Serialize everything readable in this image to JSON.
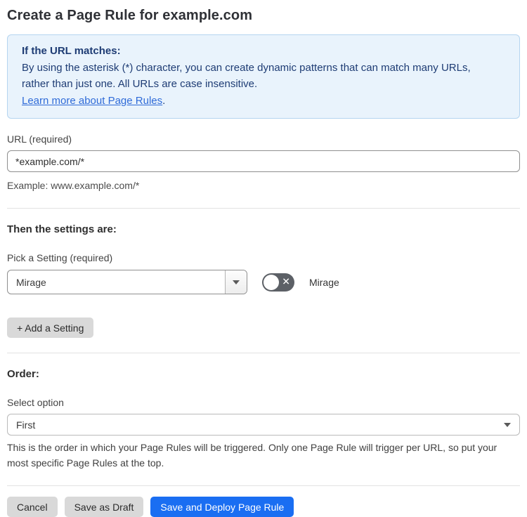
{
  "page": {
    "title": "Create a Page Rule for example.com"
  },
  "info_box": {
    "heading": "If the URL matches:",
    "body": "By using the asterisk (*) character, you can create dynamic patterns that can match many URLs, rather than just one. All URLs are case insensitive.",
    "link_label": "Learn more about Page Rules",
    "link_suffix": "."
  },
  "url_field": {
    "label": "URL (required)",
    "value": "*example.com/*",
    "helper": "Example: www.example.com/*"
  },
  "settings_section": {
    "heading": "Then the settings are:",
    "picker_label": "Pick a Setting (required)",
    "selected_setting": "Mirage",
    "toggle": {
      "label": "Mirage",
      "state": "off",
      "glyph": "✕"
    },
    "add_button_label": "+ Add a Setting"
  },
  "order_section": {
    "heading": "Order:",
    "label": "Select option",
    "selected_option": "First",
    "helper": "This is the order in which your Page Rules will be triggered. Only one Page Rule will trigger per URL, so put your most specific Page Rules at the top."
  },
  "footer": {
    "cancel_label": "Cancel",
    "save_draft_label": "Save as Draft",
    "save_deploy_label": "Save and Deploy Page Rule"
  },
  "colors": {
    "accent_blue": "#1a6ef2",
    "info_bg": "#e9f3fc",
    "info_border": "#b5d5f0",
    "info_text": "#1e3c74",
    "link_blue": "#2f6bd8",
    "toggle_off_bg": "#5c6066",
    "gray_btn_bg": "#d9d9d9",
    "divider": "#e2e2e2",
    "field_border": "#8f8f8f"
  }
}
